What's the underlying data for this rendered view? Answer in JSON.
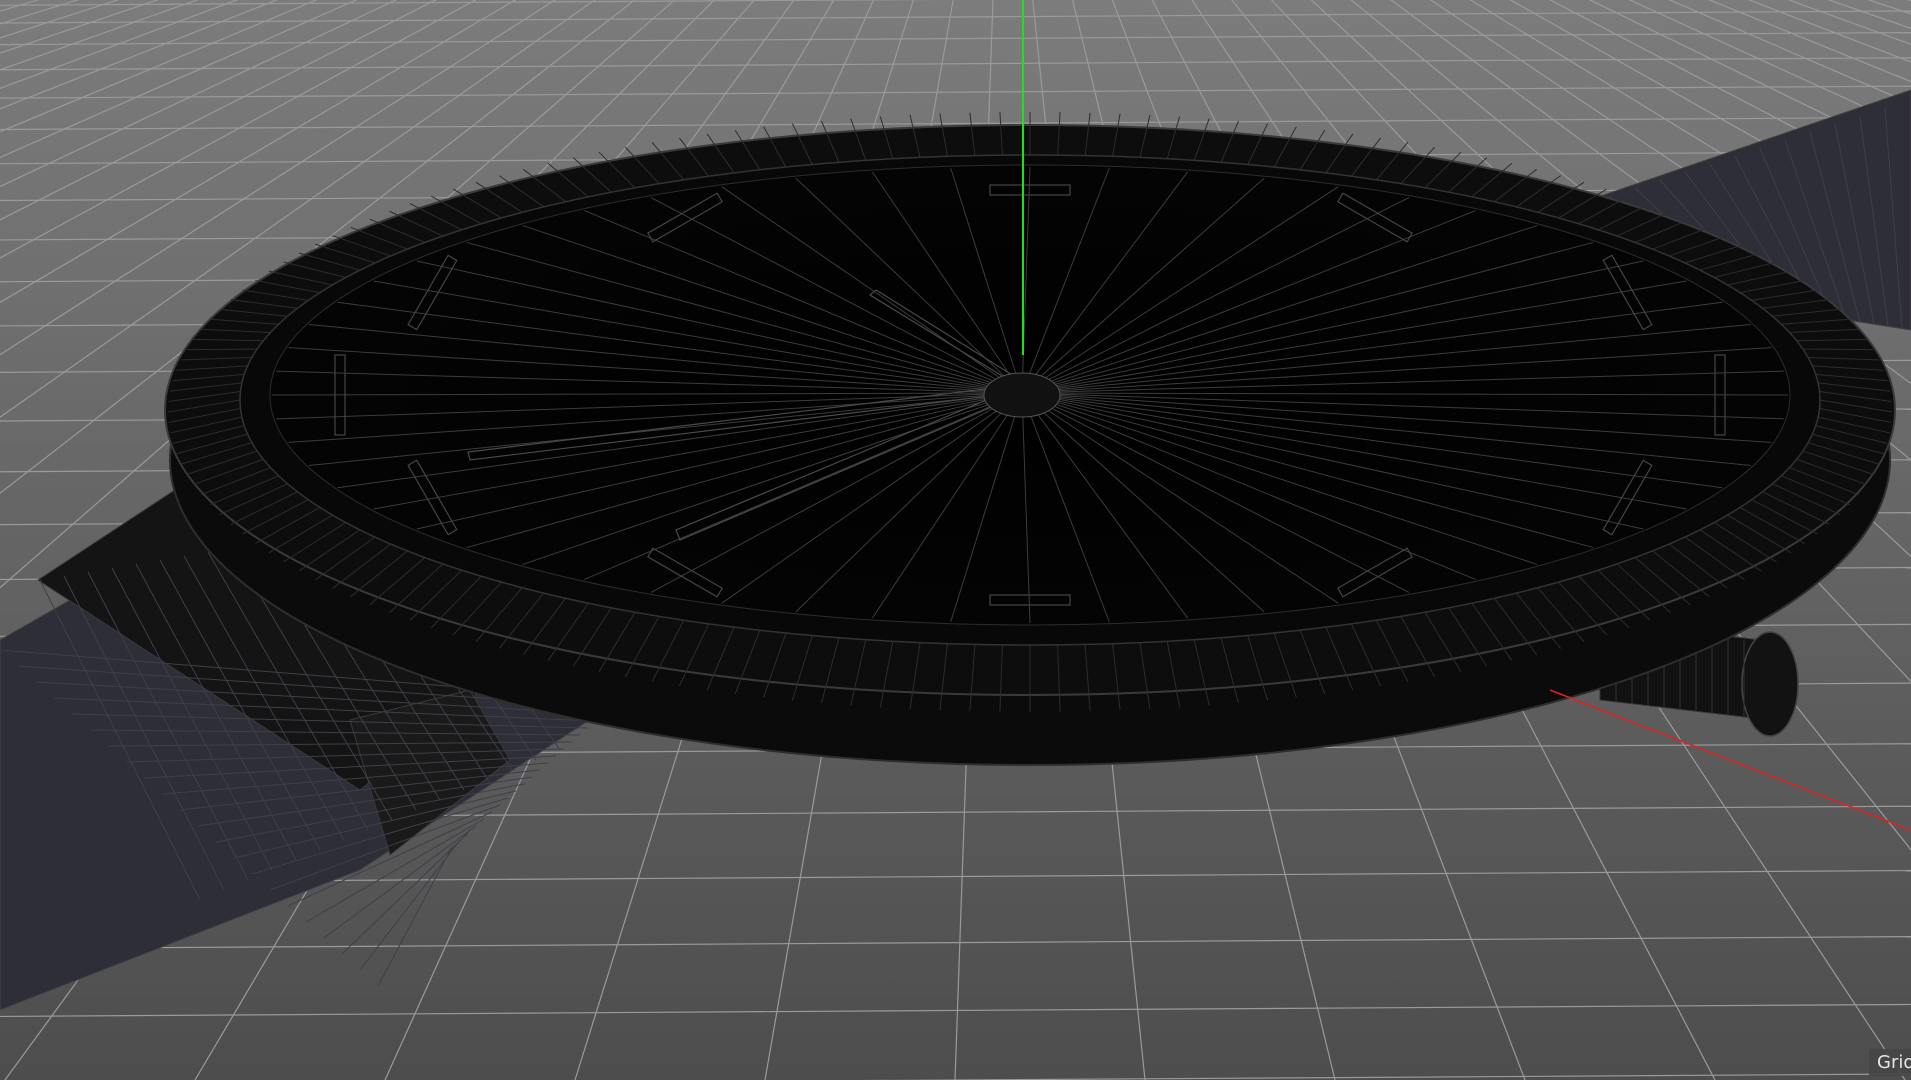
{
  "viewport": {
    "background_top": "#7a7a7a",
    "background_bottom": "#4e4e4e",
    "grid_color": "#9a9a9a",
    "model_color": "#0a0a0a",
    "wire_color": "#3c3c3c",
    "strap_color": "#2a2a33",
    "axis_y_color": "#22dd22",
    "axis_x_color": "#dd2222",
    "grid_toggle_label": "Grid"
  }
}
